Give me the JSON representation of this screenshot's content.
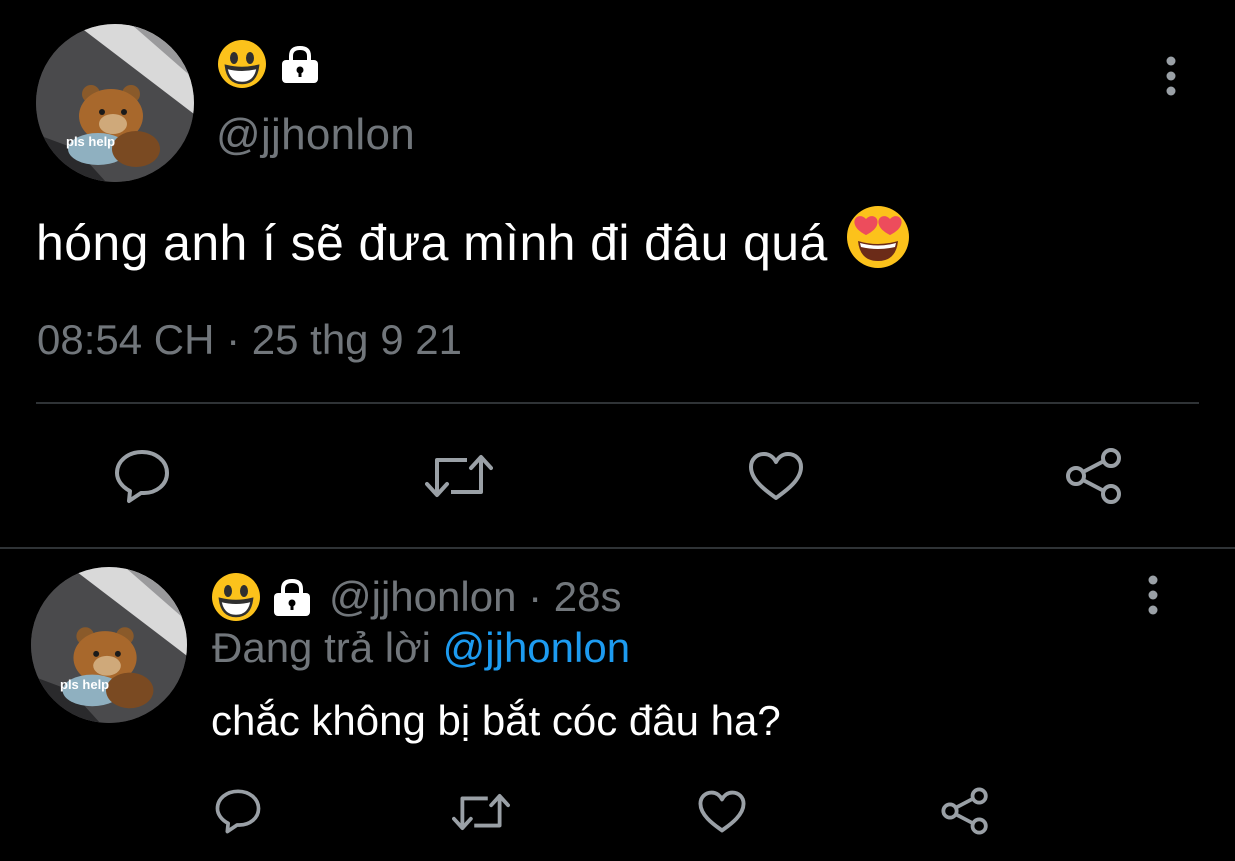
{
  "main_tweet": {
    "avatar_caption": "pls help",
    "display_name_emoji": "smiling-face-emoji",
    "protected_icon": "lock-icon",
    "handle": "@jjhonlon",
    "text": "hóng anh í sẽ đưa mình đi đâu quá",
    "text_emoji": "heart-eyes-emoji",
    "timestamp": "08:54 CH · 25 thg 9 21",
    "actions": [
      "reply-icon",
      "retweet-icon",
      "like-icon",
      "share-icon"
    ]
  },
  "reply_tweet": {
    "avatar_caption": "pls help",
    "handle_time": "@jjhonlon · 28s",
    "replying_to_prefix": "Đang trả lời",
    "replying_to_handle": "@jjhonlon",
    "text": "chắc không bị bắt cóc đâu ha?",
    "actions": [
      "reply-icon",
      "retweet-icon",
      "like-icon",
      "share-icon"
    ]
  },
  "colors": {
    "background": "#000000",
    "primary_text": "#ffffff",
    "secondary_text": "#71767b",
    "mention": "#1d9bf0",
    "divider": "#2f3336"
  }
}
